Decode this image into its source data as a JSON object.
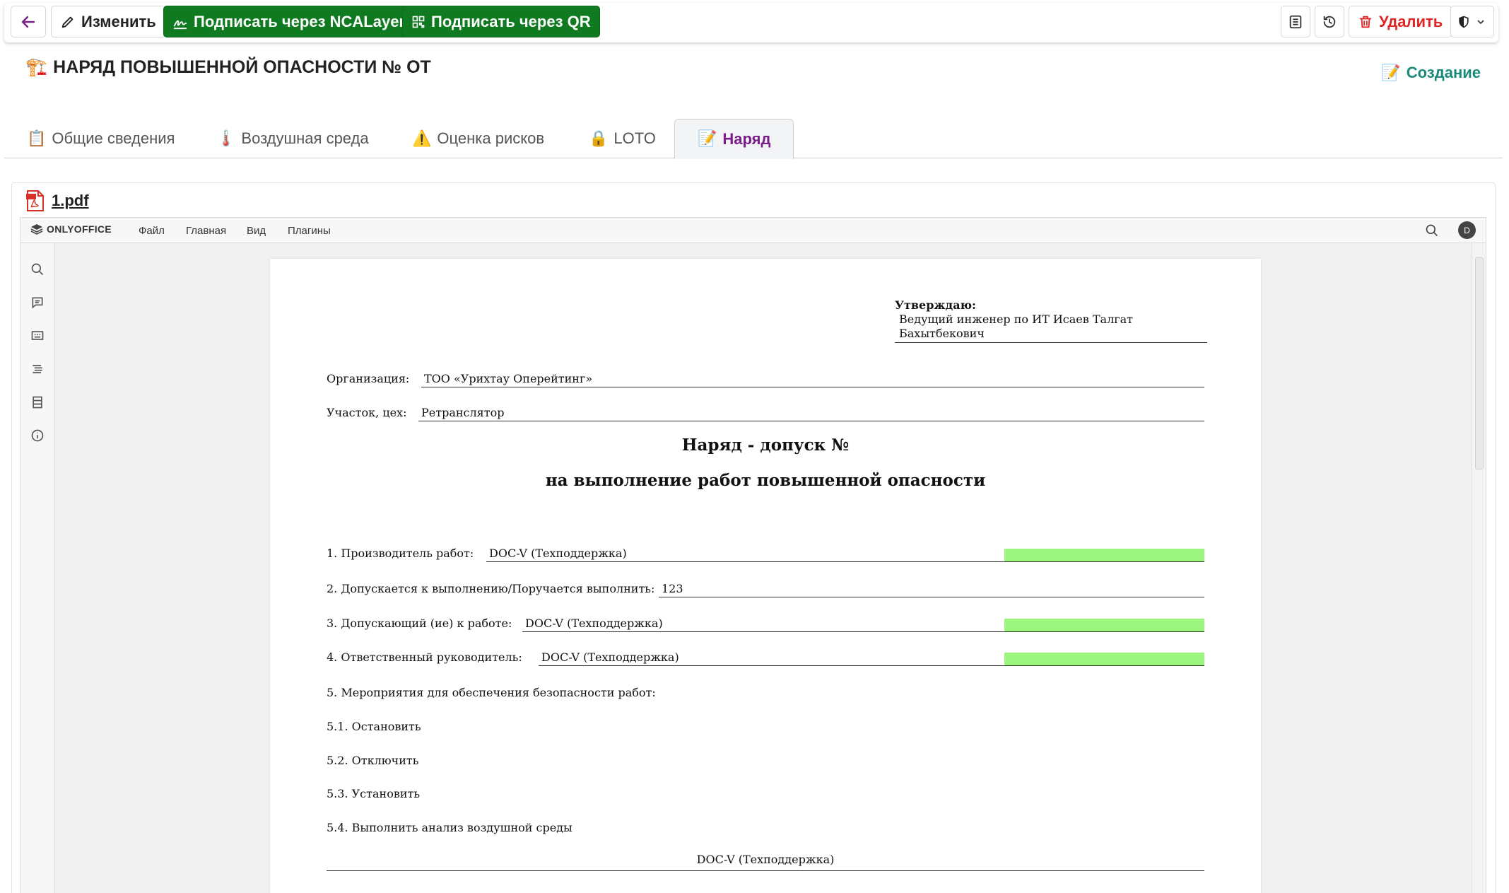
{
  "toolbar": {
    "edit_label": "Изменить",
    "sign_ncalayer_label": "Подписать через NCALayer",
    "sign_qr_label": "Подписать через QR",
    "delete_label": "Удалить",
    "accent_green": "#0f7a1f",
    "danger_red": "#e02424"
  },
  "header": {
    "icon": "🏗️",
    "title": "НАРЯД ПОВЫШЕННОЙ ОПАСНОСТИ № ОТ",
    "status_icon": "📝",
    "status": "Создание"
  },
  "tabs": [
    {
      "icon": "📋",
      "label": "Общие сведения",
      "active": false
    },
    {
      "icon": "🌡️",
      "label": "Воздушная среда",
      "active": false
    },
    {
      "icon": "⚠️",
      "label": "Оценка рисков",
      "active": false
    },
    {
      "icon": "🔒",
      "label": "LOTO",
      "active": false
    },
    {
      "icon": "📝",
      "label": "Наряд",
      "active": true
    }
  ],
  "attachment": {
    "file_name": "1.pdf"
  },
  "viewer": {
    "brand": "ONLYOFFICE",
    "menu": [
      "Файл",
      "Главная",
      "Вид",
      "Плагины"
    ],
    "avatar": "D"
  },
  "document": {
    "approve_heading": "Утверждаю:",
    "approve_line1": "Ведущий инженер по ИТ Исаев Талгат",
    "approve_line2": "Бахытбекович",
    "org_label": "Организация:",
    "org_value": "ТОО «Урихтау Оперейтинг»",
    "site_label": "Участок, цех:",
    "site_value": "Ретранслятор",
    "title1": "Наряд - допуск №",
    "title2": "на выполнение работ повышенной опасности",
    "f1_label": "1. Производитель работ:",
    "f1_value": "DOC-V (Техподдержка)",
    "f2_label": "2. Допускается к выполнению/Поручается выполнить:",
    "f2_value": "123",
    "f3_label": "3. Допускающий (ие) к работе:",
    "f3_value": "DOC-V (Техподдержка)",
    "f4_label": "4. Ответственный руководитель:",
    "f4_value": "DOC-V (Техподдержка)",
    "s5": "5. Мероприятия для обеспечения безопасности работ:",
    "s51": "5.1. Остановить",
    "s52": "5.2. Отключить",
    "s53": "5.3. Установить",
    "s54": "5.4. Выполнить анализ воздушной среды",
    "sign_value": "DOC-V (Техподдержка)",
    "highlight_color": "#9cf57f"
  }
}
